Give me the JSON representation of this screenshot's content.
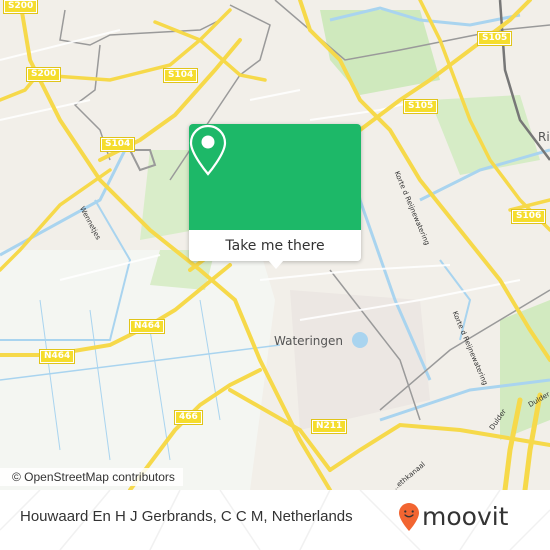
{
  "map": {
    "road_shields": [
      {
        "id": "s200-top",
        "label": "S200"
      },
      {
        "id": "s200-left",
        "label": "S200"
      },
      {
        "id": "s104-top",
        "label": "S104"
      },
      {
        "id": "s104-left",
        "label": "S104"
      },
      {
        "id": "s105-top",
        "label": "S105"
      },
      {
        "id": "s105-mid",
        "label": "S105"
      },
      {
        "id": "s106",
        "label": "S106"
      },
      {
        "id": "n464-mid",
        "label": "N464"
      },
      {
        "id": "n464-left",
        "label": "N464"
      },
      {
        "id": "r466",
        "label": "466"
      },
      {
        "id": "n211",
        "label": "N211"
      }
    ],
    "place_labels": {
      "wateringen": "Wateringen",
      "rijswijk_partial": "Ri"
    },
    "street_labels": {
      "wennetjes": "Wennetjes",
      "korte_reijnwatering_1": "Korte d Reijnewatering",
      "korte_reijnwatering_2": "Korte d Reijnewatering",
      "dulder_1": "Dulder",
      "dulder_2": "Dulder",
      "kanaal": "...ethkanaal"
    },
    "attribution": "© OpenStreetMap contributors"
  },
  "popup": {
    "action_label": "Take me there",
    "icon": "map-pin-icon",
    "accent_color": "#1db868"
  },
  "footer": {
    "location_title": "Houwaard En H J Gerbrands, C C M, Netherlands",
    "brand": "moovit",
    "brand_color": "#f26531"
  }
}
